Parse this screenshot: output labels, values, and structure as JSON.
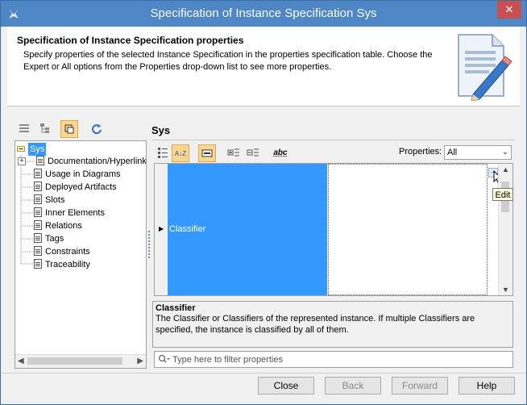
{
  "window": {
    "title": "Specification of Instance Specification Sys",
    "close_glyph": "✕"
  },
  "header": {
    "title": "Specification of Instance Specification properties",
    "description": "Specify properties of the selected Instance Specification in the properties specification table. Choose the Expert or All options from the Properties drop-down list to see more properties.",
    "icon": "document-pencil-icon"
  },
  "left_toolbar": {
    "icons": [
      "list-view-icon",
      "tree-view-icon",
      "toggle-icon",
      "refresh-icon"
    ]
  },
  "tree": {
    "root": "Sys",
    "items": [
      "Documentation/Hyperlinks",
      "Usage in Diagrams",
      "Deployed Artifacts",
      "Slots",
      "Inner Elements",
      "Relations",
      "Tags",
      "Constraints",
      "Traceability"
    ]
  },
  "right_panel": {
    "title": "Sys",
    "toolbar_icons": [
      "categorize-icon",
      "sort-alpha-icon",
      "show-toolbar-icon",
      "expand-all-icon",
      "collapse-all-icon",
      "spell-check-icon"
    ],
    "sort_glyph": "A↓Z",
    "spell_glyph": "abc",
    "properties_label": "Properties:",
    "properties_value": "All"
  },
  "table": {
    "rows": [
      {
        "name": "Classifier",
        "value": ""
      }
    ],
    "edit_button": "...",
    "tooltip": "Edit"
  },
  "description": {
    "title": "Classifier",
    "text": "The Classifier or Classifiers of the represented instance. If multiple Classifiers are specified, the instance is classified by all of them."
  },
  "filter": {
    "placeholder": "Type here to filter properties"
  },
  "buttons": {
    "close": "Close",
    "back": "Back",
    "forward": "Forward",
    "help": "Help"
  }
}
